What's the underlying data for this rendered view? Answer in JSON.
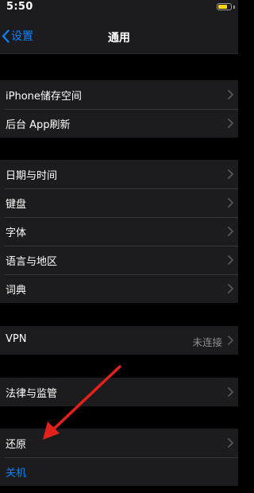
{
  "status_bar": {
    "time": "5:50",
    "battery_level": 0.75,
    "battery_color": "#ffd60a"
  },
  "nav": {
    "back_label": "设置",
    "back_icon": "chevron-left-icon",
    "title": "通用"
  },
  "groups": [
    {
      "items": [
        {
          "label": "iPhone储存空间"
        },
        {
          "label": "后台 App刷新"
        }
      ]
    },
    {
      "items": [
        {
          "label": "日期与时间"
        },
        {
          "label": "键盘"
        },
        {
          "label": "字体"
        },
        {
          "label": "语言与地区"
        },
        {
          "label": "词典"
        }
      ]
    },
    {
      "items": [
        {
          "label": "VPN",
          "value": "未连接"
        }
      ]
    },
    {
      "items": [
        {
          "label": "法律与监管"
        }
      ]
    },
    {
      "items": [
        {
          "label": "还原"
        },
        {
          "label": "关机"
        }
      ]
    }
  ],
  "colors": {
    "accent": "#0a84ff",
    "annotation_arrow": "#e3211c",
    "cell_background": "#1c1c1e",
    "page_background": "#000000"
  },
  "icons": {
    "row_chevron": "chevron-right-icon",
    "annotation": "red-arrow-icon"
  }
}
